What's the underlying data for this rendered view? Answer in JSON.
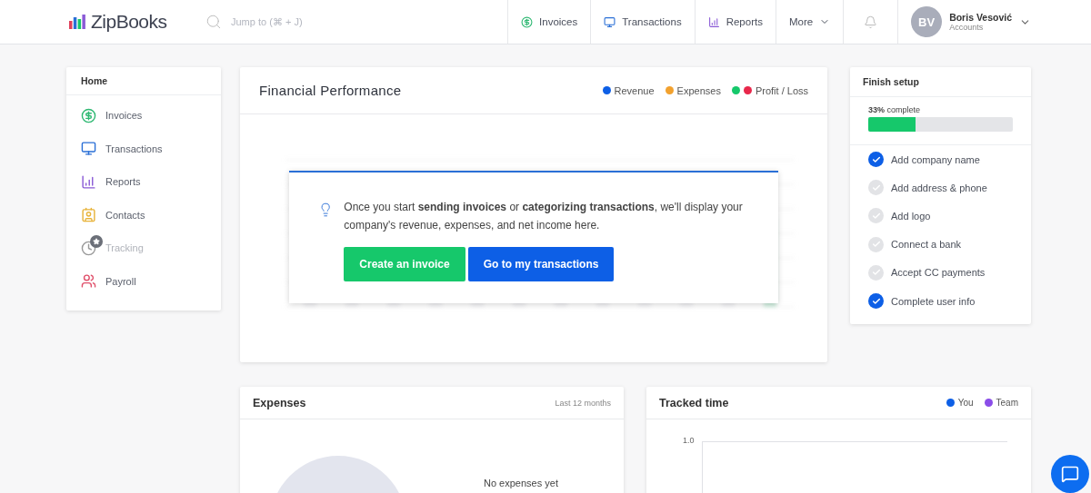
{
  "header": {
    "logo": "ZipBooks",
    "search": {
      "placeholder": "Jump to (⌘ + J)"
    },
    "nav": [
      {
        "label": "Invoices"
      },
      {
        "label": "Transactions"
      },
      {
        "label": "Reports"
      }
    ],
    "more": "More",
    "user": {
      "initials": "BV",
      "name": "Boris Vesović",
      "subtitle": "Accounts"
    }
  },
  "sidebar": {
    "title": "Home",
    "items": [
      {
        "label": "Invoices",
        "disabled": false
      },
      {
        "label": "Transactions",
        "disabled": false
      },
      {
        "label": "Reports",
        "disabled": false
      },
      {
        "label": "Contacts",
        "disabled": false
      },
      {
        "label": "Tracking",
        "disabled": true
      },
      {
        "label": "Payroll",
        "disabled": false
      }
    ]
  },
  "performance": {
    "title": "Financial Performance",
    "legend": [
      {
        "label": "Revenue",
        "dots": [
          {
            "color": "#0d5fe6"
          }
        ]
      },
      {
        "label": "Expenses",
        "dots": [
          {
            "color": "#f2a12e"
          }
        ]
      },
      {
        "label": "Profit / Loss",
        "dots": [
          {
            "color": "#16c86b"
          },
          {
            "color": "#e8274b"
          }
        ]
      }
    ],
    "notice": {
      "text": "Once you start **sending invoices** or **categorizing transactions**, we'll display your company's revenue, expenses, and net income here.",
      "buttons": [
        {
          "label": "Create an invoice",
          "kind": "primary"
        },
        {
          "label": "Go to my transactions",
          "kind": "secondary"
        }
      ]
    }
  },
  "setup": {
    "title": "Finish setup",
    "progress": {
      "label": "**33%** complete",
      "level": 0.33
    },
    "tasks": [
      {
        "label": "Add company name",
        "checked": true
      },
      {
        "label": "Add address & phone",
        "checked": false
      },
      {
        "label": "Add logo",
        "checked": false
      },
      {
        "label": "Connect a bank",
        "checked": false
      },
      {
        "label": "Accept CC payments",
        "checked": false
      },
      {
        "label": "Complete user info",
        "checked": true
      }
    ]
  },
  "expenses": {
    "title": "Expenses",
    "period": "Last 12 months",
    "empty": "No expenses yet"
  },
  "tracked": {
    "title": "Tracked time",
    "legend": [
      {
        "label": "You",
        "color": "#0d5fe6"
      },
      {
        "label": "Team",
        "color": "#8a4de8"
      }
    ],
    "tick": "1.0"
  }
}
